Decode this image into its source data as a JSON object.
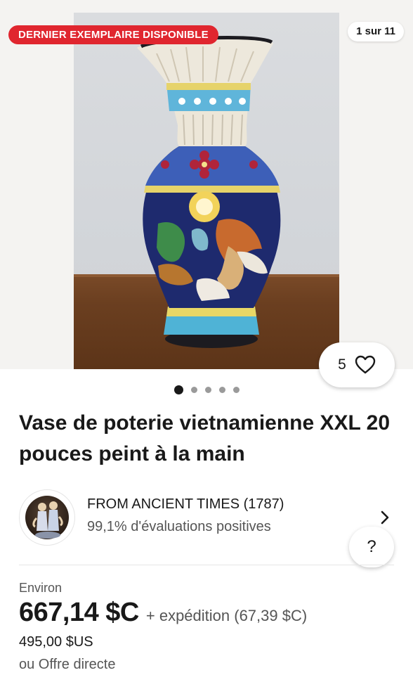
{
  "gallery": {
    "badge": "DERNIER EXEMPLAIRE DISPONIBLE",
    "counter": "1 sur 11",
    "watch_count": "5",
    "dots": 5,
    "active_dot": 0
  },
  "listing": {
    "title": "Vase de poterie vietnamienne XXL 20 pouces peint à la main"
  },
  "seller": {
    "name": "FROM ANCIENT TIMES (1787)",
    "rating": "99,1% d'évaluations positives",
    "help": "?"
  },
  "price": {
    "approx_label": "Environ",
    "amount": "667,14 $C",
    "shipping": "+ expédition (67,39 $C)",
    "original": "495,00 $US",
    "offer": "ou Offre directe"
  },
  "colors": {
    "badge": "#e0262f",
    "text": "#191919",
    "muted": "#555555"
  }
}
